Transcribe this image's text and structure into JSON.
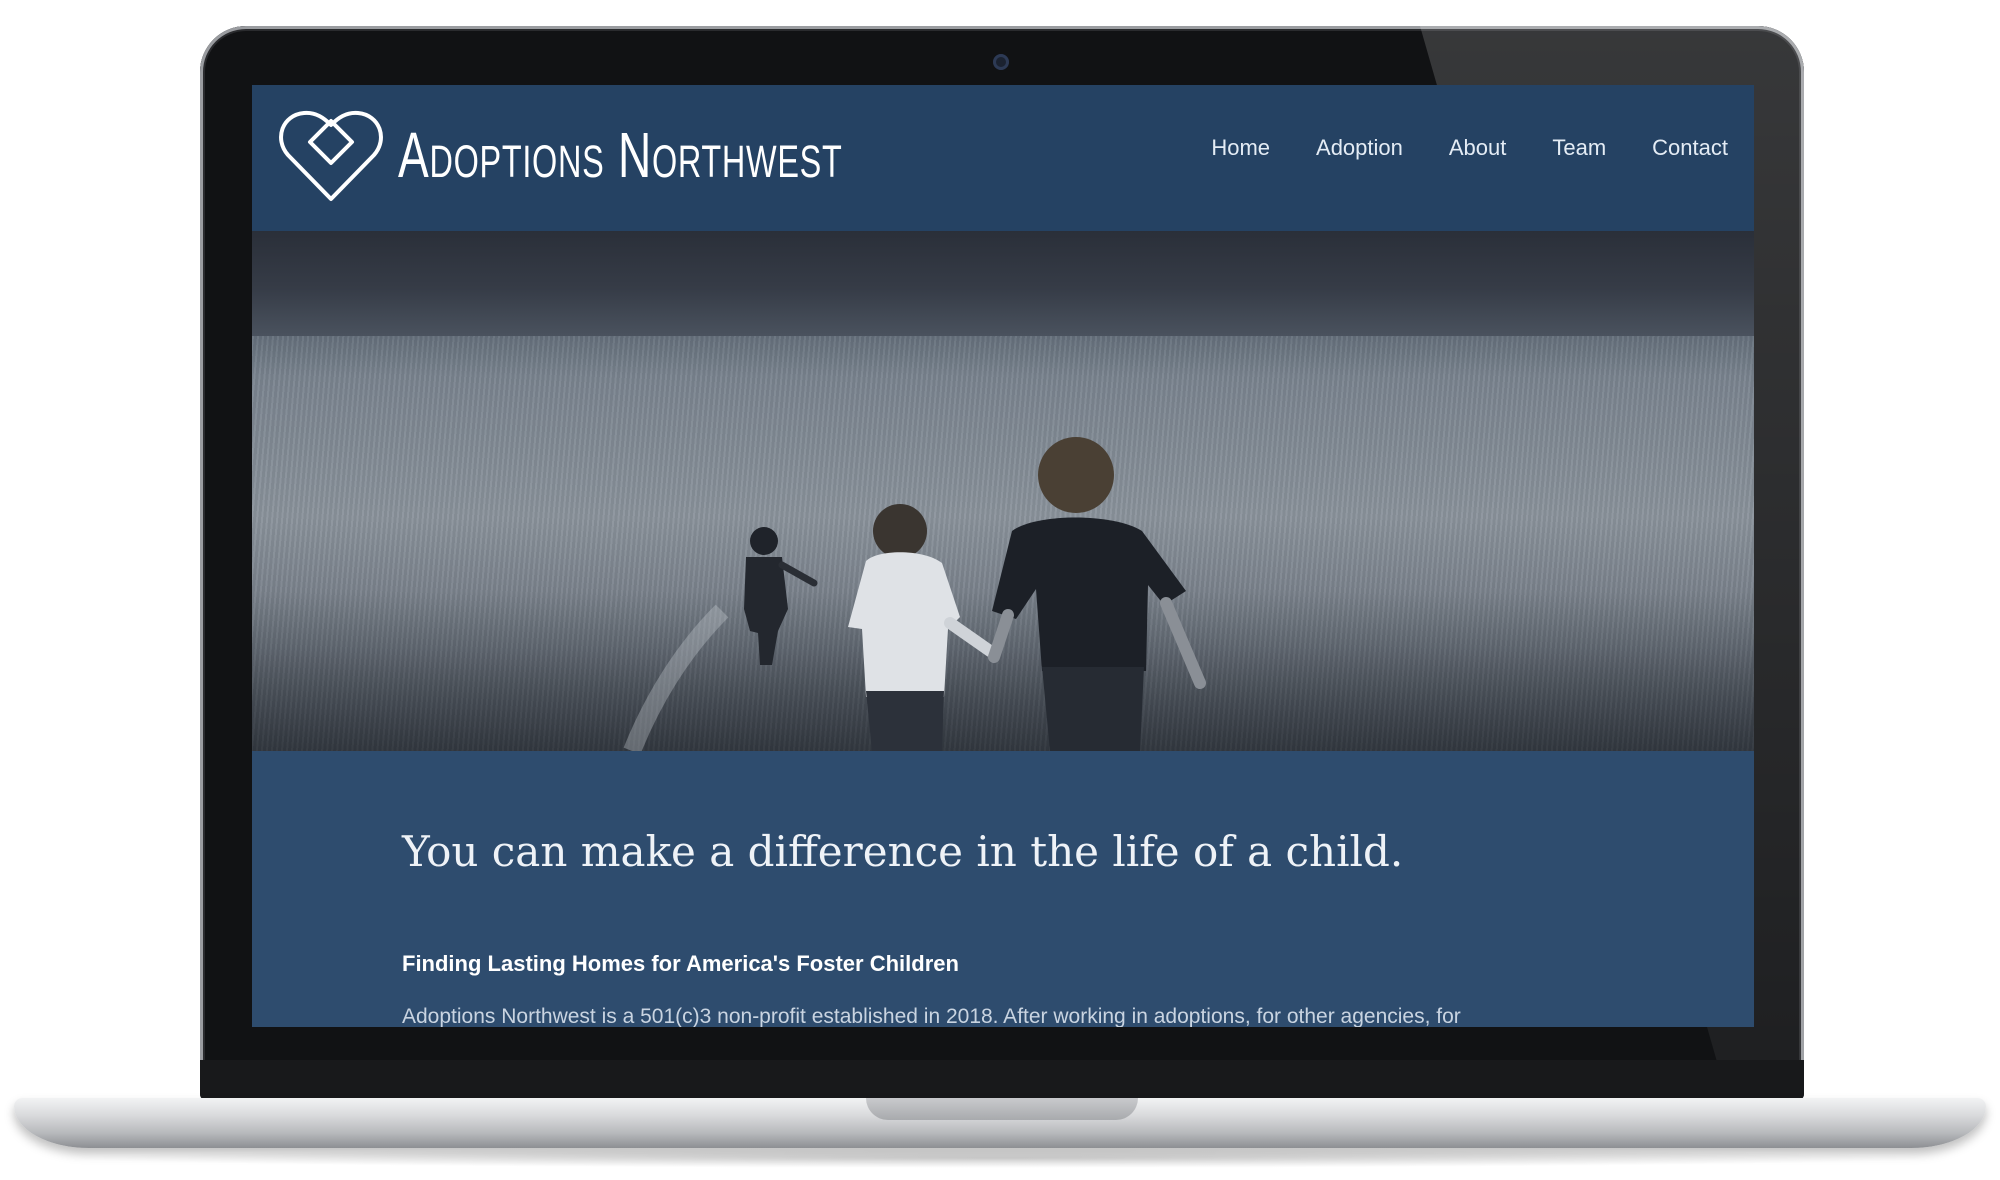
{
  "site": {
    "logo_text": "Adoptions Northwest",
    "nav": [
      "Home",
      "Adoption",
      "About",
      "Team",
      "Contact"
    ]
  },
  "main": {
    "headline": "You can make a difference in the life of a child.",
    "subheading": "Finding Lasting Homes for America's Foster Children",
    "body": "Adoptions Northwest is a 501(c)3 non-profit established in 2018. After working in adoptions, for other agencies, for"
  },
  "hero": {
    "image": "children-running-in-field-photo"
  },
  "colors": {
    "header_bg": "#254263",
    "content_bg": "#2e4c6e",
    "nav_text": "#e4ecf5",
    "laptop_bezel": "#111214"
  },
  "icons": {
    "logo": "heart-diamond-logo-icon",
    "camera": "webcam-icon"
  }
}
